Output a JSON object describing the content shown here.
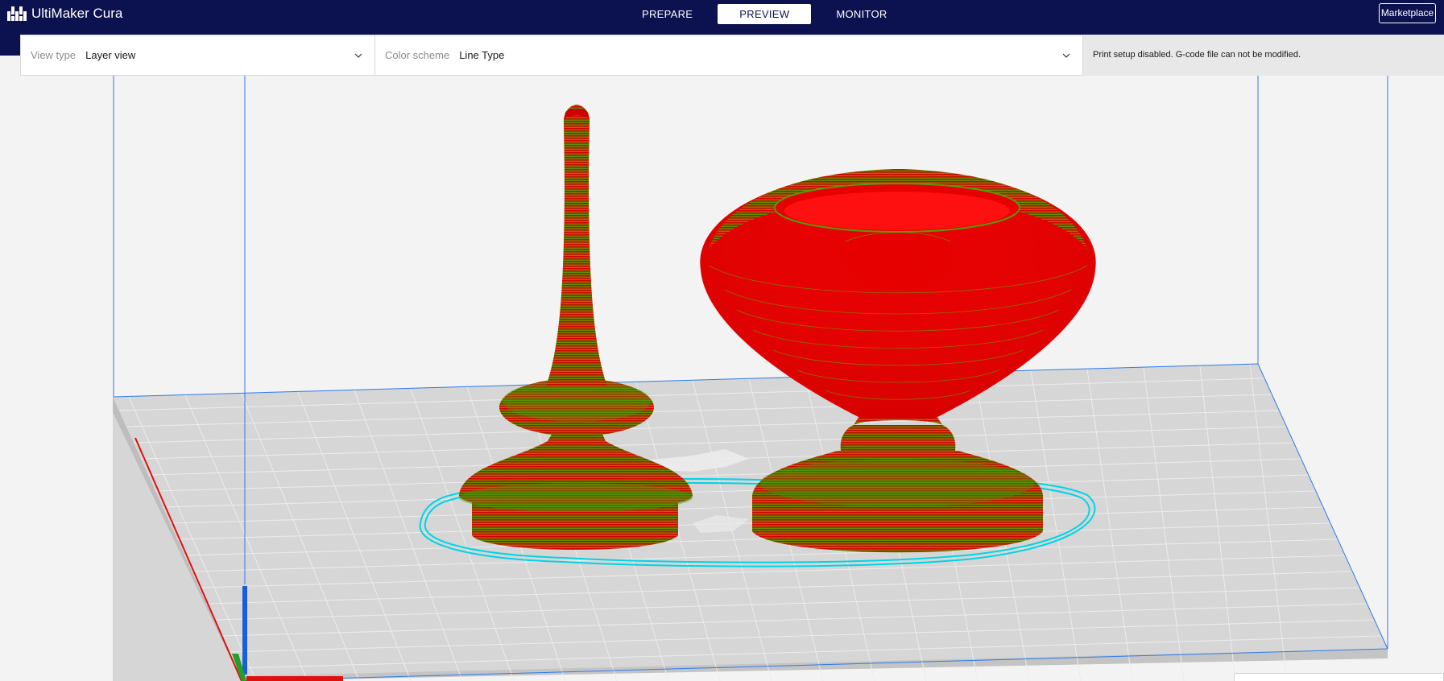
{
  "app": {
    "name": "UltiMaker Cura",
    "logo_icon": "ultimaker-logo-icon"
  },
  "stages": [
    {
      "label": "PREPARE",
      "active": false
    },
    {
      "label": "PREVIEW",
      "active": true
    },
    {
      "label": "MONITOR",
      "active": false
    }
  ],
  "marketplace_label": "Marketplace",
  "view_options": {
    "view_type_label": "View type",
    "view_type_value": "Layer view",
    "color_scheme_label": "Color scheme",
    "color_scheme_value": "Line Type",
    "chevron_icon": "chevron-down-icon"
  },
  "notice": "Print setup disabled. G-code file can not be modified.",
  "colors": {
    "header": "#0c1150",
    "wall_outer": "#e60000",
    "wall_inner": "#2fa500",
    "skirt": "#00d4e6",
    "build_volume_edge": "#2f7be8",
    "build_plate": "#d6d6d6",
    "axis_x": "#e01010",
    "axis_y": "#1a5fd6",
    "axis_z": "#22a02a"
  }
}
